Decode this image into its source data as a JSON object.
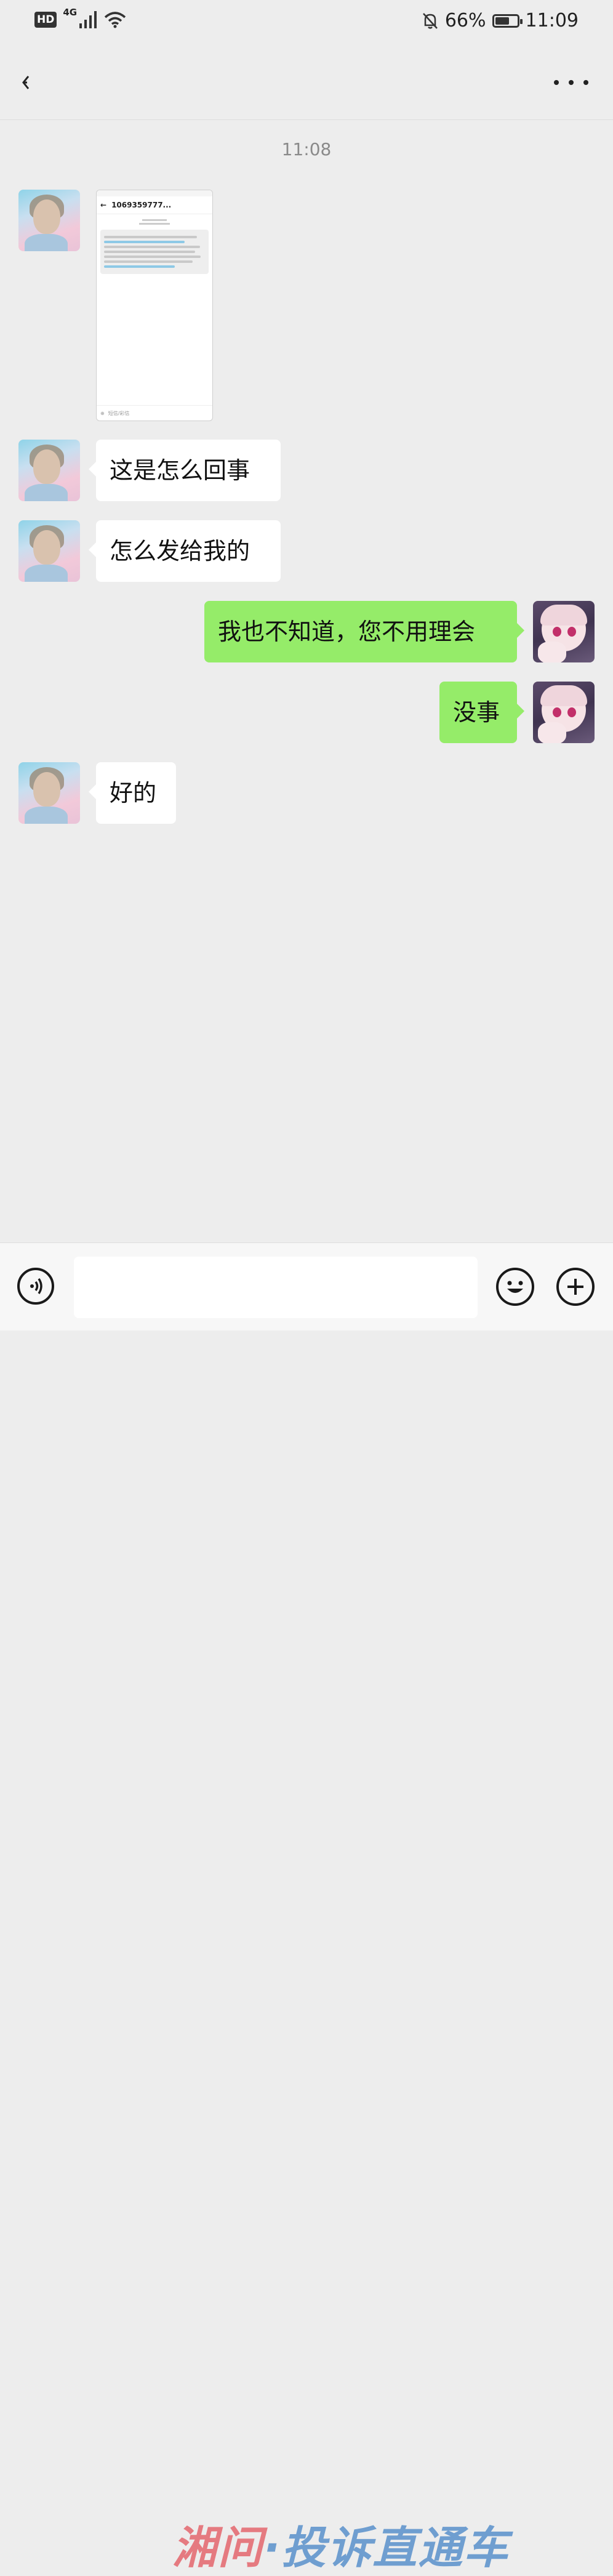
{
  "status_bar": {
    "hd": "HD",
    "network": "4G",
    "battery_percent": "66%",
    "battery_level": 0.66,
    "time": "11:09"
  },
  "nav": {
    "back_icon": "back-arrow-icon",
    "more_icon": "more-dots-icon"
  },
  "chat": {
    "timestamp": "11:08",
    "image_message": {
      "sender_number": "1069359777...",
      "input_hint": "短信/彩信"
    },
    "messages": [
      {
        "side": "in",
        "text": "这是怎么回事"
      },
      {
        "side": "in",
        "text": "怎么发给我的"
      },
      {
        "side": "out",
        "text": "我也不知道，您不用理会"
      },
      {
        "side": "out",
        "text": "没事"
      },
      {
        "side": "in",
        "text": "好的"
      }
    ]
  },
  "input_bar": {
    "voice_icon": "voice-icon",
    "emoji_icon": "emoji-icon",
    "plus_icon": "plus-icon",
    "text_value": ""
  },
  "watermark": {
    "part1": "湘问",
    "part2": "·投诉直通车"
  },
  "colors": {
    "background": "#ededed",
    "bubble_in": "#ffffff",
    "bubble_out": "#95ec69"
  }
}
